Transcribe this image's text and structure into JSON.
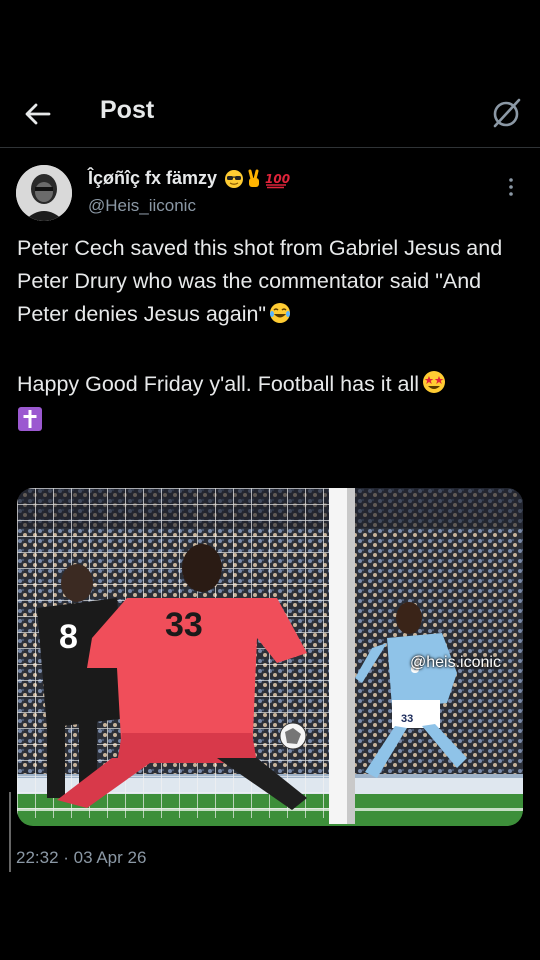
{
  "header": {
    "title": "Post"
  },
  "author": {
    "name": "Îçøñîç fx fämzy",
    "handle": "@Heis_iiconic"
  },
  "tweet": {
    "paragraphs": [
      "Peter Cech saved this shot from Gabriel Jesus and Peter Drury who was the commentator said \"And Peter denies Jesus again\"",
      "Happy Good Friday y'all. Football has it all"
    ]
  },
  "media": {
    "watermark": "@heis.iconic",
    "keeper_number": "33",
    "defender_number": "8",
    "striker_number": "33"
  },
  "meta": {
    "timestamp": "22:32 · 03 Apr 26"
  },
  "colors": {
    "background": "#000000",
    "text": "#e7e9ea",
    "muted": "#8b98a5",
    "keeper_kit": "#f04e5a",
    "pitch": "#3d8f3a"
  },
  "icons": [
    "back-arrow-icon",
    "grok-slash-icon",
    "more-icon",
    "sunglasses-emoji",
    "victory-hand-emoji",
    "hundred-emoji",
    "tears-of-joy-emoji",
    "star-struck-emoji",
    "latin-cross-emoji",
    "tiktok-icon"
  ]
}
